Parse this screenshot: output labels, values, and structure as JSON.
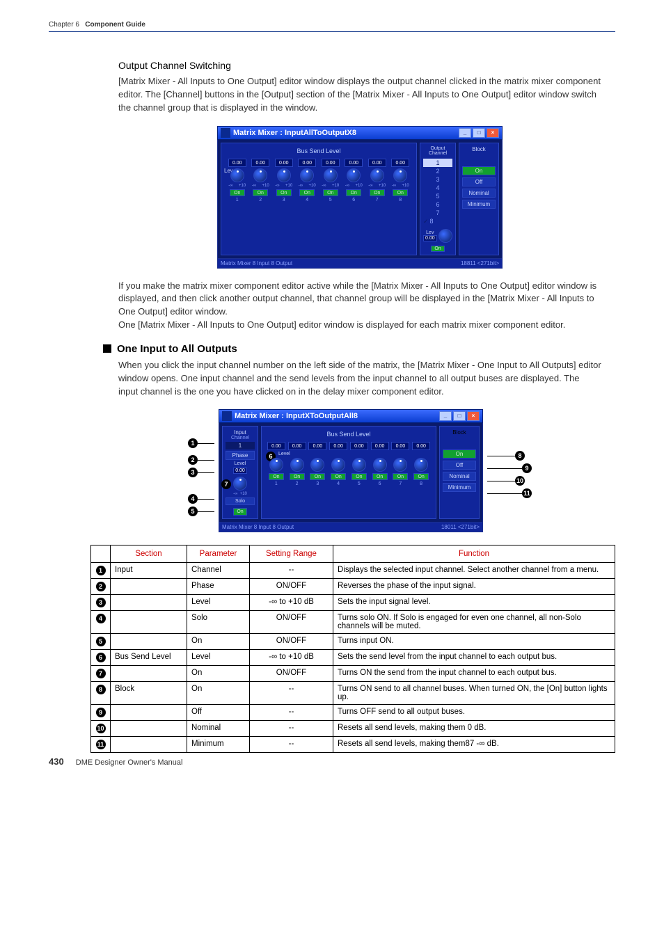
{
  "chapter_label": "Chapter 6",
  "chapter_title": "Component Guide",
  "section1": {
    "heading": "Output Channel Switching",
    "para1": "[Matrix Mixer - All Inputs to One Output] editor window displays the output channel clicked in the matrix mixer component editor. The [Channel] buttons in the [Output] section of the [Matrix Mixer - All Inputs to One Output] editor window switch the channel group that is displayed in the window.",
    "para2": "If you make the matrix mixer component editor active while the [Matrix Mixer - All Inputs to One Output] editor window is displayed, and then click another output channel, that channel group will be displayed in the [Matrix Mixer - All Inputs to One Output] editor window.",
    "para3": "One [Matrix Mixer - All Inputs to One Output] editor window is displayed for each matrix mixer component editor."
  },
  "fig1": {
    "title": "Matrix Mixer : InputAllToOutputX8",
    "bus_send_label": "Bus Send Level",
    "level_label": "Level",
    "vals": [
      "0.00",
      "0.00",
      "0.00",
      "0.00",
      "0.00",
      "0.00",
      "0.00",
      "0.00"
    ],
    "scale_lo": "-∞",
    "scale_hi": "+10",
    "on": "On",
    "chs": [
      "1",
      "2",
      "3",
      "4",
      "5",
      "6",
      "7",
      "8"
    ],
    "out_title": "Output\nChannel",
    "out_items": [
      "1",
      "2",
      "3",
      "4",
      "5",
      "6",
      "7",
      "8"
    ],
    "lev_label": "Lev",
    "lev_val": "0.00",
    "block_title": "Block",
    "block_on": "On",
    "block_off": "Off",
    "block_nom": "Nominal",
    "block_min": "Minimum",
    "status_left": "Matrix Mixer    8 Input 8 Output",
    "status_right": "18811 <271bit>"
  },
  "section2": {
    "heading": "One Input to All Outputs",
    "para": "When you click the input channel number on the left side of the matrix, the [Matrix Mixer - One Input to All Outputs] editor window opens. One input channel and the send levels from the input channel to all output buses are displayed. The input channel is the one you have clicked on in the delay mixer component editor."
  },
  "fig2": {
    "title": "Matrix Mixer : InputXToOutputAll8",
    "input_label": "Input",
    "channel_label": "Channel",
    "ch_val": "1",
    "phase": "Phase",
    "level": "Level",
    "lev_val": "0.00",
    "solo": "Solo",
    "on": "On",
    "bus_send_label": "Bus Send Level",
    "vals": [
      "0.00",
      "0.00",
      "0.00",
      "0.00",
      "0.00",
      "0.00",
      "0.00",
      "0.00"
    ],
    "chs": [
      "1",
      "2",
      "3",
      "4",
      "5",
      "6",
      "7",
      "8"
    ],
    "block_title": "Block",
    "block_on": "On",
    "block_off": "Off",
    "block_nom": "Nominal",
    "block_min": "Minimum",
    "status_left": "Matrix Mixer    8 Input 8 Output",
    "status_right": "18011 <271bit>"
  },
  "callouts": {
    "c1": "1",
    "c2": "2",
    "c3": "3",
    "c4": "4",
    "c5": "5",
    "c6": "6",
    "c7": "7",
    "c8": "8",
    "c9": "9",
    "c10": "10",
    "c11": "11"
  },
  "table": {
    "headers": {
      "section": "Section",
      "parameter": "Parameter",
      "range": "Setting Range",
      "func": "Function"
    },
    "rows": [
      {
        "n": "1",
        "section": "Input",
        "param": "Channel",
        "range": "--",
        "func": "Displays the selected input channel. Select another channel from a menu."
      },
      {
        "n": "2",
        "section": "",
        "param": "Phase",
        "range": "ON/OFF",
        "func": "Reverses the phase of the input signal."
      },
      {
        "n": "3",
        "section": "",
        "param": "Level",
        "range": "-∞ to +10 dB",
        "func": "Sets the input signal level."
      },
      {
        "n": "4",
        "section": "",
        "param": "Solo",
        "range": "ON/OFF",
        "func": "Turns solo ON. If Solo is engaged for even one channel, all non-Solo channels will be muted."
      },
      {
        "n": "5",
        "section": "",
        "param": "On",
        "range": "ON/OFF",
        "func": "Turns input ON."
      },
      {
        "n": "6",
        "section": "Bus Send Level",
        "param": "Level",
        "range": "-∞ to +10 dB",
        "func": "Sets the send level from the input channel to each output bus."
      },
      {
        "n": "7",
        "section": "",
        "param": "On",
        "range": "ON/OFF",
        "func": "Turns ON the send from the input channel to each output bus."
      },
      {
        "n": "8",
        "section": "Block",
        "param": "On",
        "range": "--",
        "func": "Turns ON send to all channel buses. When turned ON, the [On] button lights up."
      },
      {
        "n": "9",
        "section": "",
        "param": "Off",
        "range": "--",
        "func": "Turns OFF send to all output buses."
      },
      {
        "n": "10",
        "section": "",
        "param": "Nominal",
        "range": "--",
        "func": "Resets all send levels, making them 0 dB."
      },
      {
        "n": "11",
        "section": "",
        "param": "Minimum",
        "range": "--",
        "func": "Resets all send levels, making them87 -∞ dB."
      }
    ]
  },
  "footer": {
    "page": "430",
    "manual": "DME Designer Owner's Manual"
  }
}
